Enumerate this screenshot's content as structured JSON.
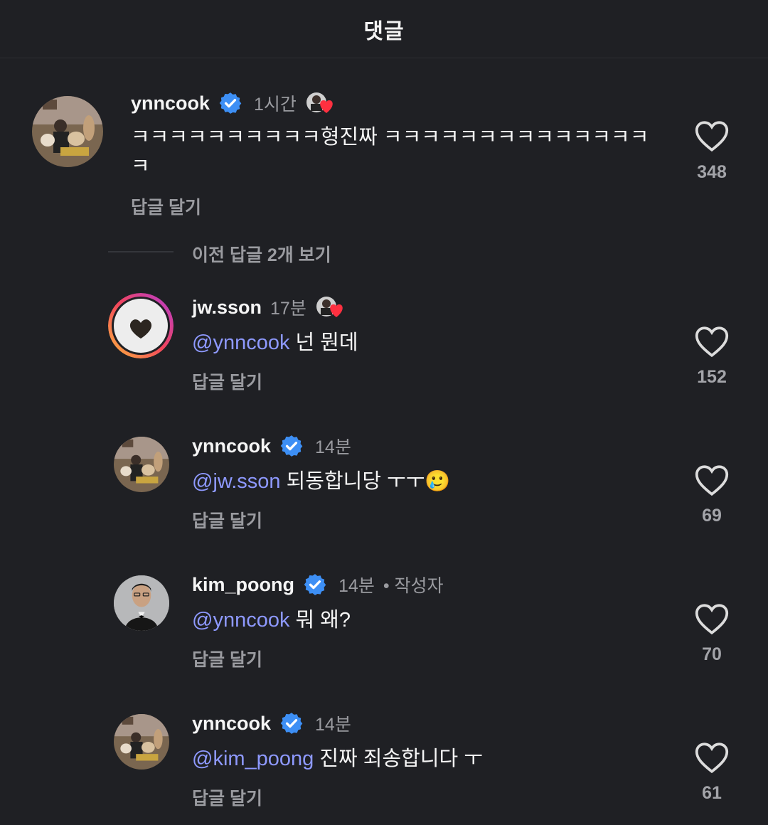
{
  "header": {
    "title": "댓글"
  },
  "comments": [
    {
      "username": "ynncook",
      "verified": true,
      "time": "1시간",
      "text": "ㅋㅋㅋㅋㅋㅋㅋㅋㅋㅋ형진짜 ㅋㅋㅋㅋㅋㅋㅋㅋㅋㅋㅋㅋㅋㅋ",
      "text_line2": "ㅋ",
      "reply_label": "답글 달기",
      "likes": "348",
      "liked_by_author": true
    }
  ],
  "view_replies": {
    "label": "이전 답글 2개 보기"
  },
  "replies": [
    {
      "username": "jw.sson",
      "verified": false,
      "time": "17분",
      "mention": "@ynncook",
      "text": " 넌 뭔데",
      "reply_label": "답글 달기",
      "likes": "152",
      "liked_by_author": true
    },
    {
      "username": "ynncook",
      "verified": true,
      "time": "14분",
      "mention": "@jw.sson",
      "text": " 되동합니당 ㅜㅜ",
      "emoji": "🥲",
      "reply_label": "답글 달기",
      "likes": "69"
    },
    {
      "username": "kim_poong",
      "verified": true,
      "time": "14분",
      "author_tag": "• 작성자",
      "mention": "@ynncook",
      "text": " 뭐 왜?",
      "reply_label": "답글 달기",
      "likes": "70"
    },
    {
      "username": "ynncook",
      "verified": true,
      "time": "14분",
      "mention": "@kim_poong",
      "text": " 진짜 죄송합니다 ㅜ",
      "reply_label": "답글 달기",
      "likes": "61"
    }
  ],
  "colors": {
    "background": "#1f2024",
    "mention": "#8e99ff",
    "verified": "#3d8ff5",
    "heart": "#ff3040"
  },
  "icons": {
    "verified": "verified-badge-icon",
    "like": "heart-outline-icon",
    "liked_by_author": "author-liked-heart-icon"
  }
}
